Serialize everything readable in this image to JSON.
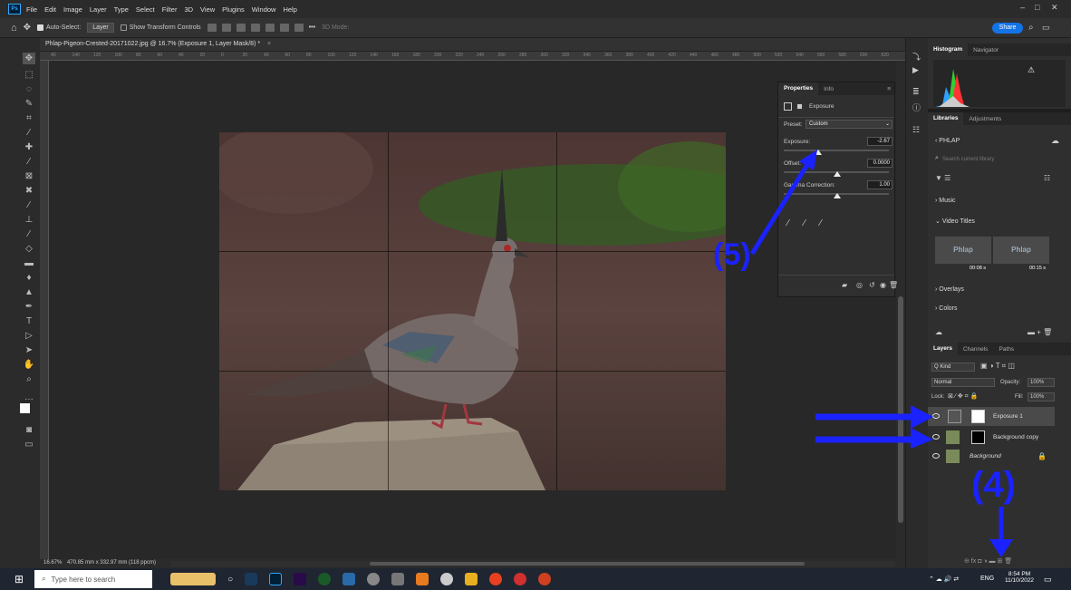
{
  "menubar": {
    "logo": "Ps",
    "items": [
      "File",
      "Edit",
      "Image",
      "Layer",
      "Type",
      "Select",
      "Filter",
      "3D",
      "View",
      "Plugins",
      "Window",
      "Help"
    ]
  },
  "options": {
    "auto_select": "Auto-Select:",
    "layer_select": "Layer",
    "show_transform": "Show Transform Controls",
    "mode_3d": "3D Mode:",
    "share": "Share"
  },
  "document": {
    "tab_title": "Phlap-Pigeon-Crested-20171022.jpg @ 16.7% (Exposure 1, Layer Mask/8) *",
    "status": "16.67%",
    "status_dims": "470.85 mm x 332.97 mm (118 ppcm)"
  },
  "ruler": {
    "marks": [
      "40",
      "140",
      "120",
      "100",
      "80",
      "60",
      "40",
      "20",
      "0",
      "20",
      "40",
      "60",
      "80",
      "100",
      "120",
      "140",
      "160",
      "180",
      "200",
      "220",
      "240",
      "260",
      "280",
      "300",
      "320",
      "340",
      "360",
      "380",
      "400",
      "420",
      "440",
      "460",
      "480",
      "500",
      "520",
      "540",
      "560",
      "580",
      "600",
      "620"
    ]
  },
  "properties": {
    "tab_properties": "Properties",
    "tab_info": "Info",
    "title": "Exposure",
    "preset_label": "Preset:",
    "preset_value": "Custom",
    "exposure_label": "Exposure:",
    "exposure_value": "-2.67",
    "offset_label": "Offset:",
    "offset_value": "0.0000",
    "gamma_label": "Gamma Correction:",
    "gamma_value": "1.00"
  },
  "histogram": {
    "tab_histogram": "Histogram",
    "tab_navigator": "Navigator"
  },
  "libraries": {
    "tab_libraries": "Libraries",
    "tab_adjustments": "Adjustments",
    "library_name": "PHLAP",
    "search_placeholder": "Search current library",
    "sections": [
      "Music",
      "Video Titles",
      "Overlays",
      "Colors"
    ],
    "thumb1_text": "Phlap",
    "thumb1_time": "00:08 s",
    "thumb2_text": "Phlap",
    "thumb2_time": "00:15 s"
  },
  "layers": {
    "tab_layers": "Layers",
    "tab_channels": "Channels",
    "tab_paths": "Paths",
    "kind": "Q Kind",
    "blend": "Normal",
    "opacity_label": "Opacity:",
    "opacity": "100%",
    "lock_label": "Lock:",
    "fill_label": "Fill:",
    "fill": "100%",
    "items": [
      {
        "name": "Exposure 1"
      },
      {
        "name": "Background copy"
      },
      {
        "name": "Background"
      }
    ]
  },
  "annotations": {
    "label4": "(4)",
    "label5": "(5)"
  },
  "taskbar": {
    "search_placeholder": "Type here to search",
    "lang": "ENG",
    "time": "8:54 PM",
    "date": "11/10/2022"
  },
  "colors": {
    "accent": "#1473e6",
    "annotation": "#1a22ff"
  }
}
